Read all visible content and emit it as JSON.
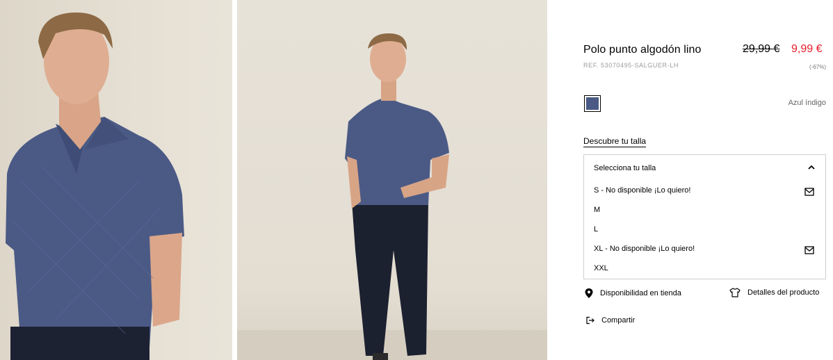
{
  "product": {
    "title": "Polo punto algodón lino",
    "ref": "REF. 53070495-SALGUER-LH",
    "price_old": "29,99 €",
    "price_new": "9,99 €",
    "discount": "(-67%)",
    "color_name": "Azul índigo",
    "swatch_color": "#4a5a85",
    "sale_color": "#e41c2a"
  },
  "size_guide_label": "Descubre tu talla",
  "size_select": {
    "header": "Selecciona tu talla",
    "options": [
      "S - No disponible ¡Lo quiero!",
      "M",
      "L",
      "XL - No disponible ¡Lo quiero!",
      "XXL"
    ]
  },
  "actions": {
    "store": "Disponibilidad en tienda",
    "details": "Detalles del producto",
    "share": "Compartir"
  },
  "icons": [
    "location-pin-icon",
    "tshirt-icon",
    "share-icon",
    "mail-icon",
    "chevron-up-icon"
  ]
}
